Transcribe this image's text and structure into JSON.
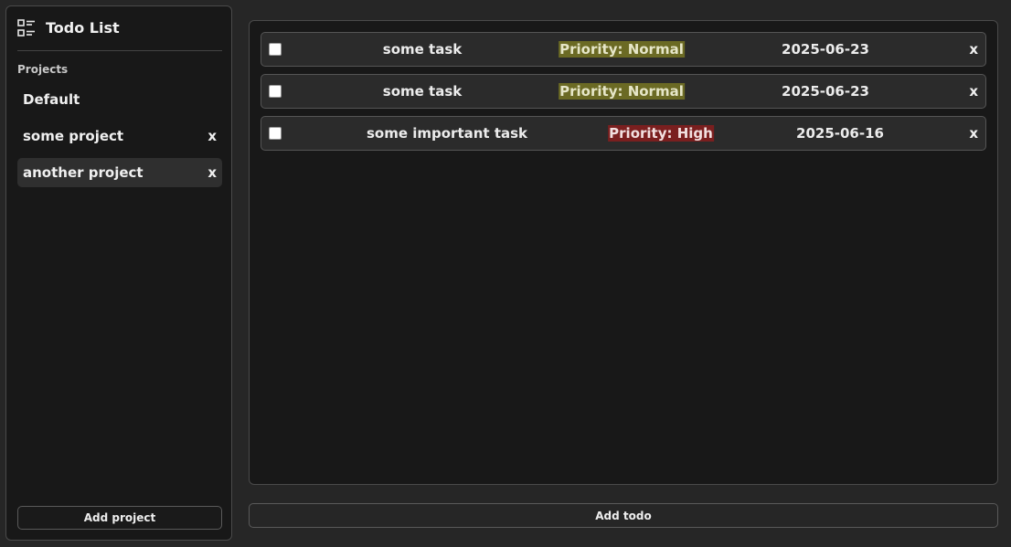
{
  "sidebar": {
    "title": "Todo List",
    "title_icon": "list-icon",
    "section_label": "Projects",
    "projects": [
      {
        "name": "Default",
        "delete_label": ""
      },
      {
        "name": "some project",
        "delete_label": "x"
      },
      {
        "name": "another project",
        "delete_label": "x",
        "active": true
      }
    ],
    "add_project_label": "Add project"
  },
  "todos": [
    {
      "title": "some task",
      "priority": "Priority: Normal",
      "priority_level": "normal",
      "date": "2025-06-23",
      "delete_label": "x",
      "checked": false
    },
    {
      "title": "some task",
      "priority": "Priority: Normal",
      "priority_level": "normal",
      "date": "2025-06-23",
      "delete_label": "x",
      "checked": false
    },
    {
      "title": "some important task",
      "priority": "Priority: High",
      "priority_level": "high",
      "date": "2025-06-16",
      "delete_label": "x",
      "checked": false
    }
  ],
  "add_todo_label": "Add todo",
  "colors": {
    "background": "#262626",
    "panel": "#181818",
    "priority_normal": "#6b6a24",
    "priority_high": "#7a1f1f"
  }
}
